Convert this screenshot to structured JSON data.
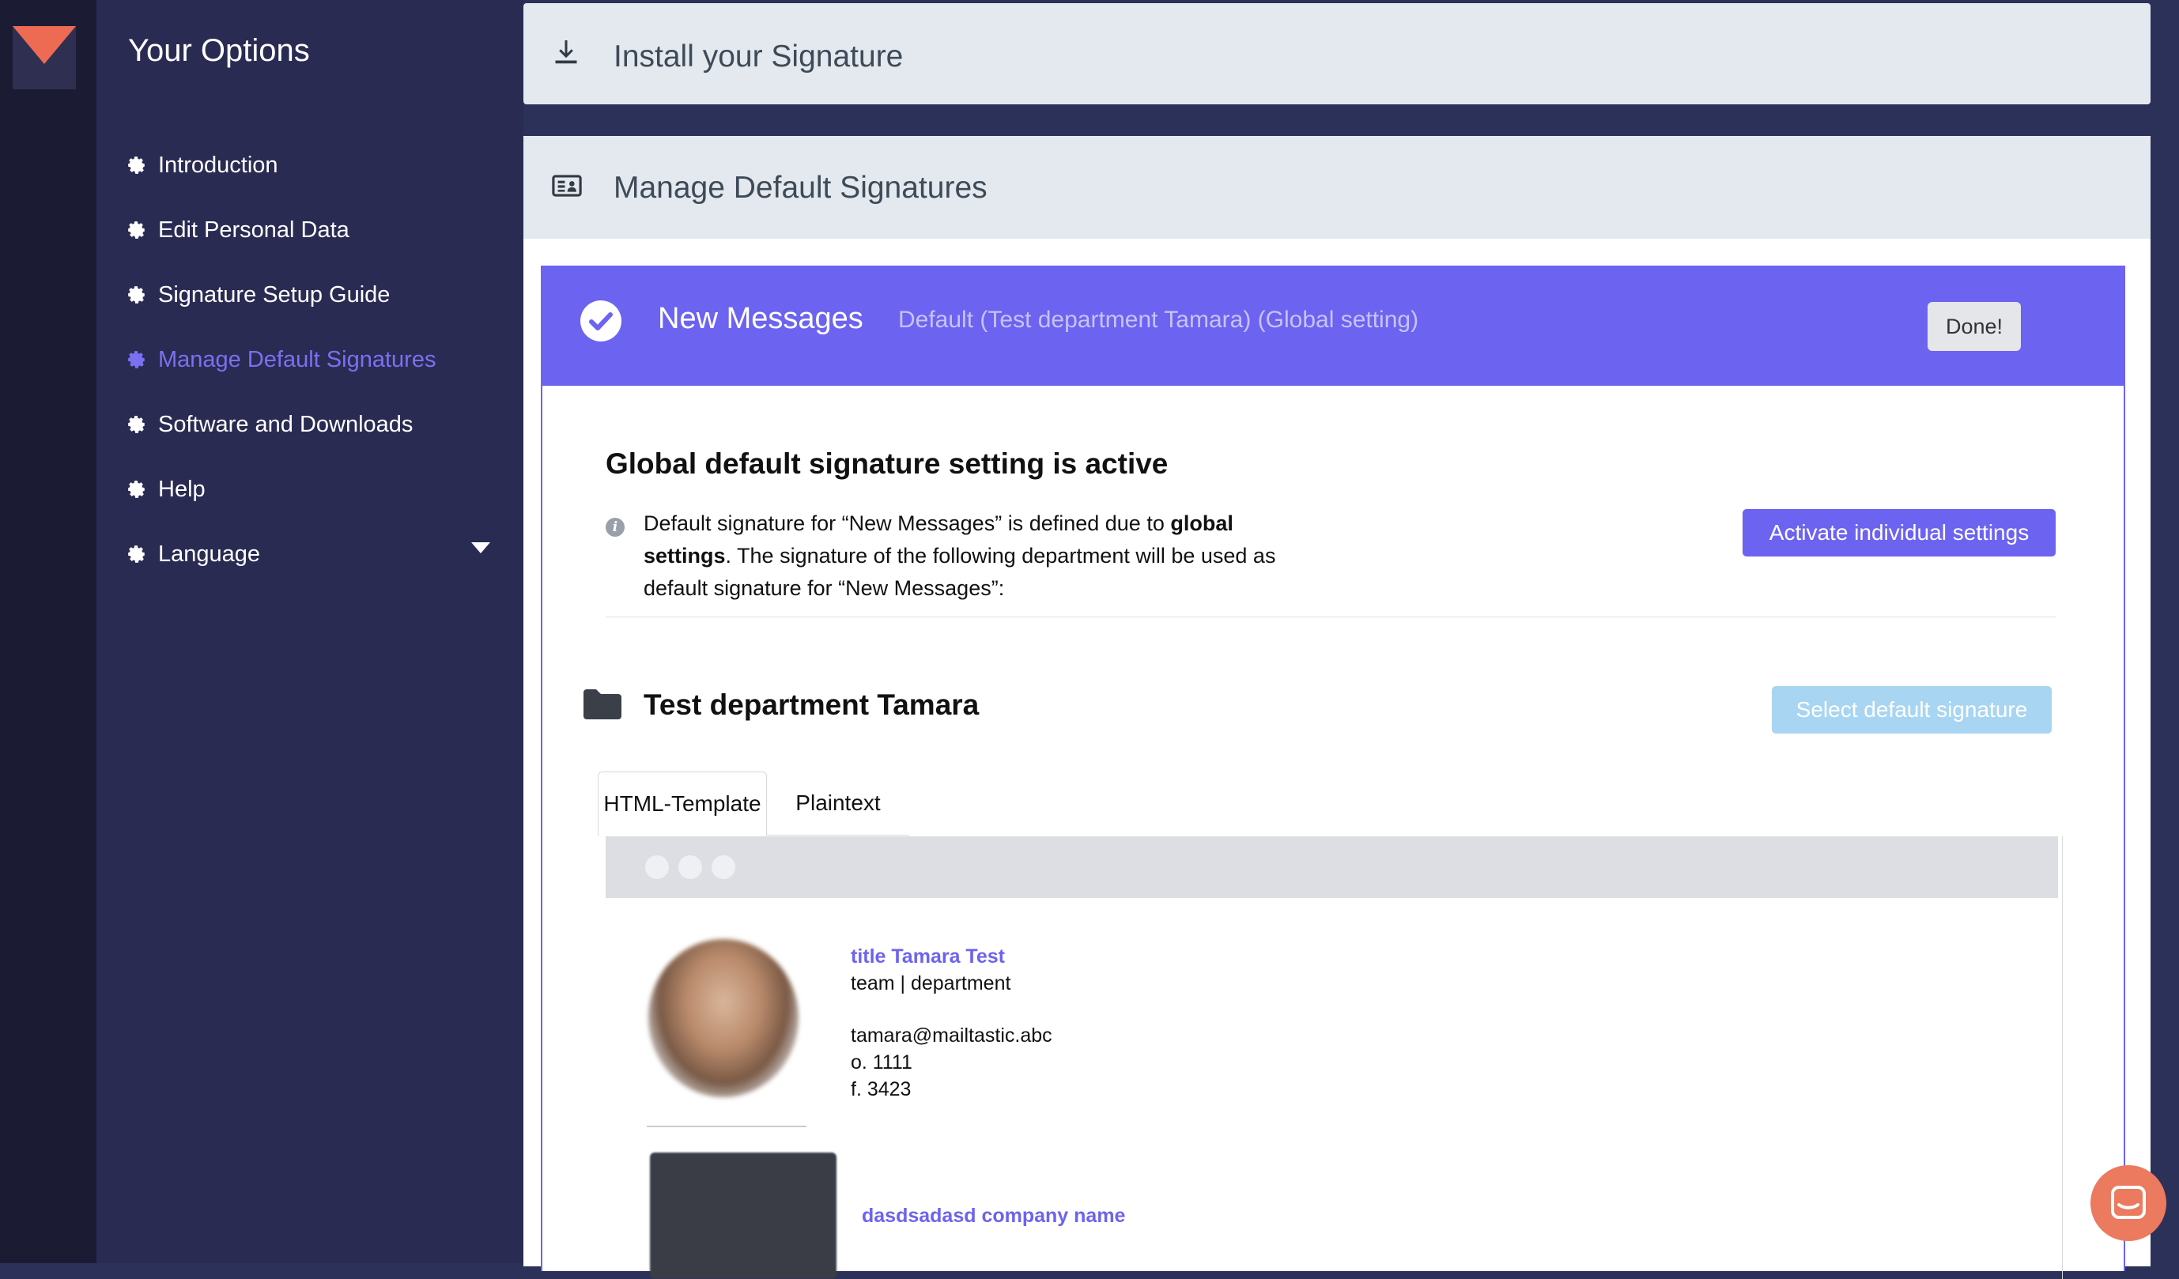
{
  "sidebar": {
    "title": "Your Options",
    "items": [
      {
        "label": "Introduction",
        "active": false
      },
      {
        "label": "Edit Personal Data",
        "active": false
      },
      {
        "label": "Signature Setup Guide",
        "active": false
      },
      {
        "label": "Manage Default Signatures",
        "active": true
      },
      {
        "label": "Software and Downloads",
        "active": false
      },
      {
        "label": "Help",
        "active": false
      },
      {
        "label": "Language",
        "active": false
      }
    ],
    "item_icon": "gear-icon",
    "language_icon": "caret-down-icon"
  },
  "sections": {
    "install": {
      "label": "Install your Signature",
      "icon": "download-icon"
    },
    "manage": {
      "label": "Manage Default Signatures",
      "icon": "id-card-icon"
    }
  },
  "card": {
    "title": "New Messages",
    "subtitle": "Default (Test department Tamara) (Global setting)",
    "done_label": "Done!",
    "status_icon": "check-circle-icon"
  },
  "global": {
    "heading": "Global default signature setting is active",
    "info_part1": "Default signature for “New Messages” is defined due to ",
    "info_bold": "global settings",
    "info_part2": ". The signature of the following department will be used as default signature for “New Messages”:",
    "activate_label": "Activate individual settings"
  },
  "department": {
    "name": "Test department Tamara",
    "select_label": "Select default signature",
    "icon": "folder-icon"
  },
  "tabs": [
    "HTML-Template",
    "Plaintext"
  ],
  "signature": {
    "name": "title Tamara Test",
    "team": "team | department",
    "email": "tamara@mailtastic.abc",
    "office": "o. 1111",
    "fax": "f. 3423",
    "company": "dasdsadasd company name"
  },
  "colors": {
    "accent": "#6c63f0",
    "sidebar_bg": "#2a2b52",
    "rail_bg": "#1b1c33",
    "chat": "#ec7a5f",
    "select_button": "#a8d5f1"
  }
}
